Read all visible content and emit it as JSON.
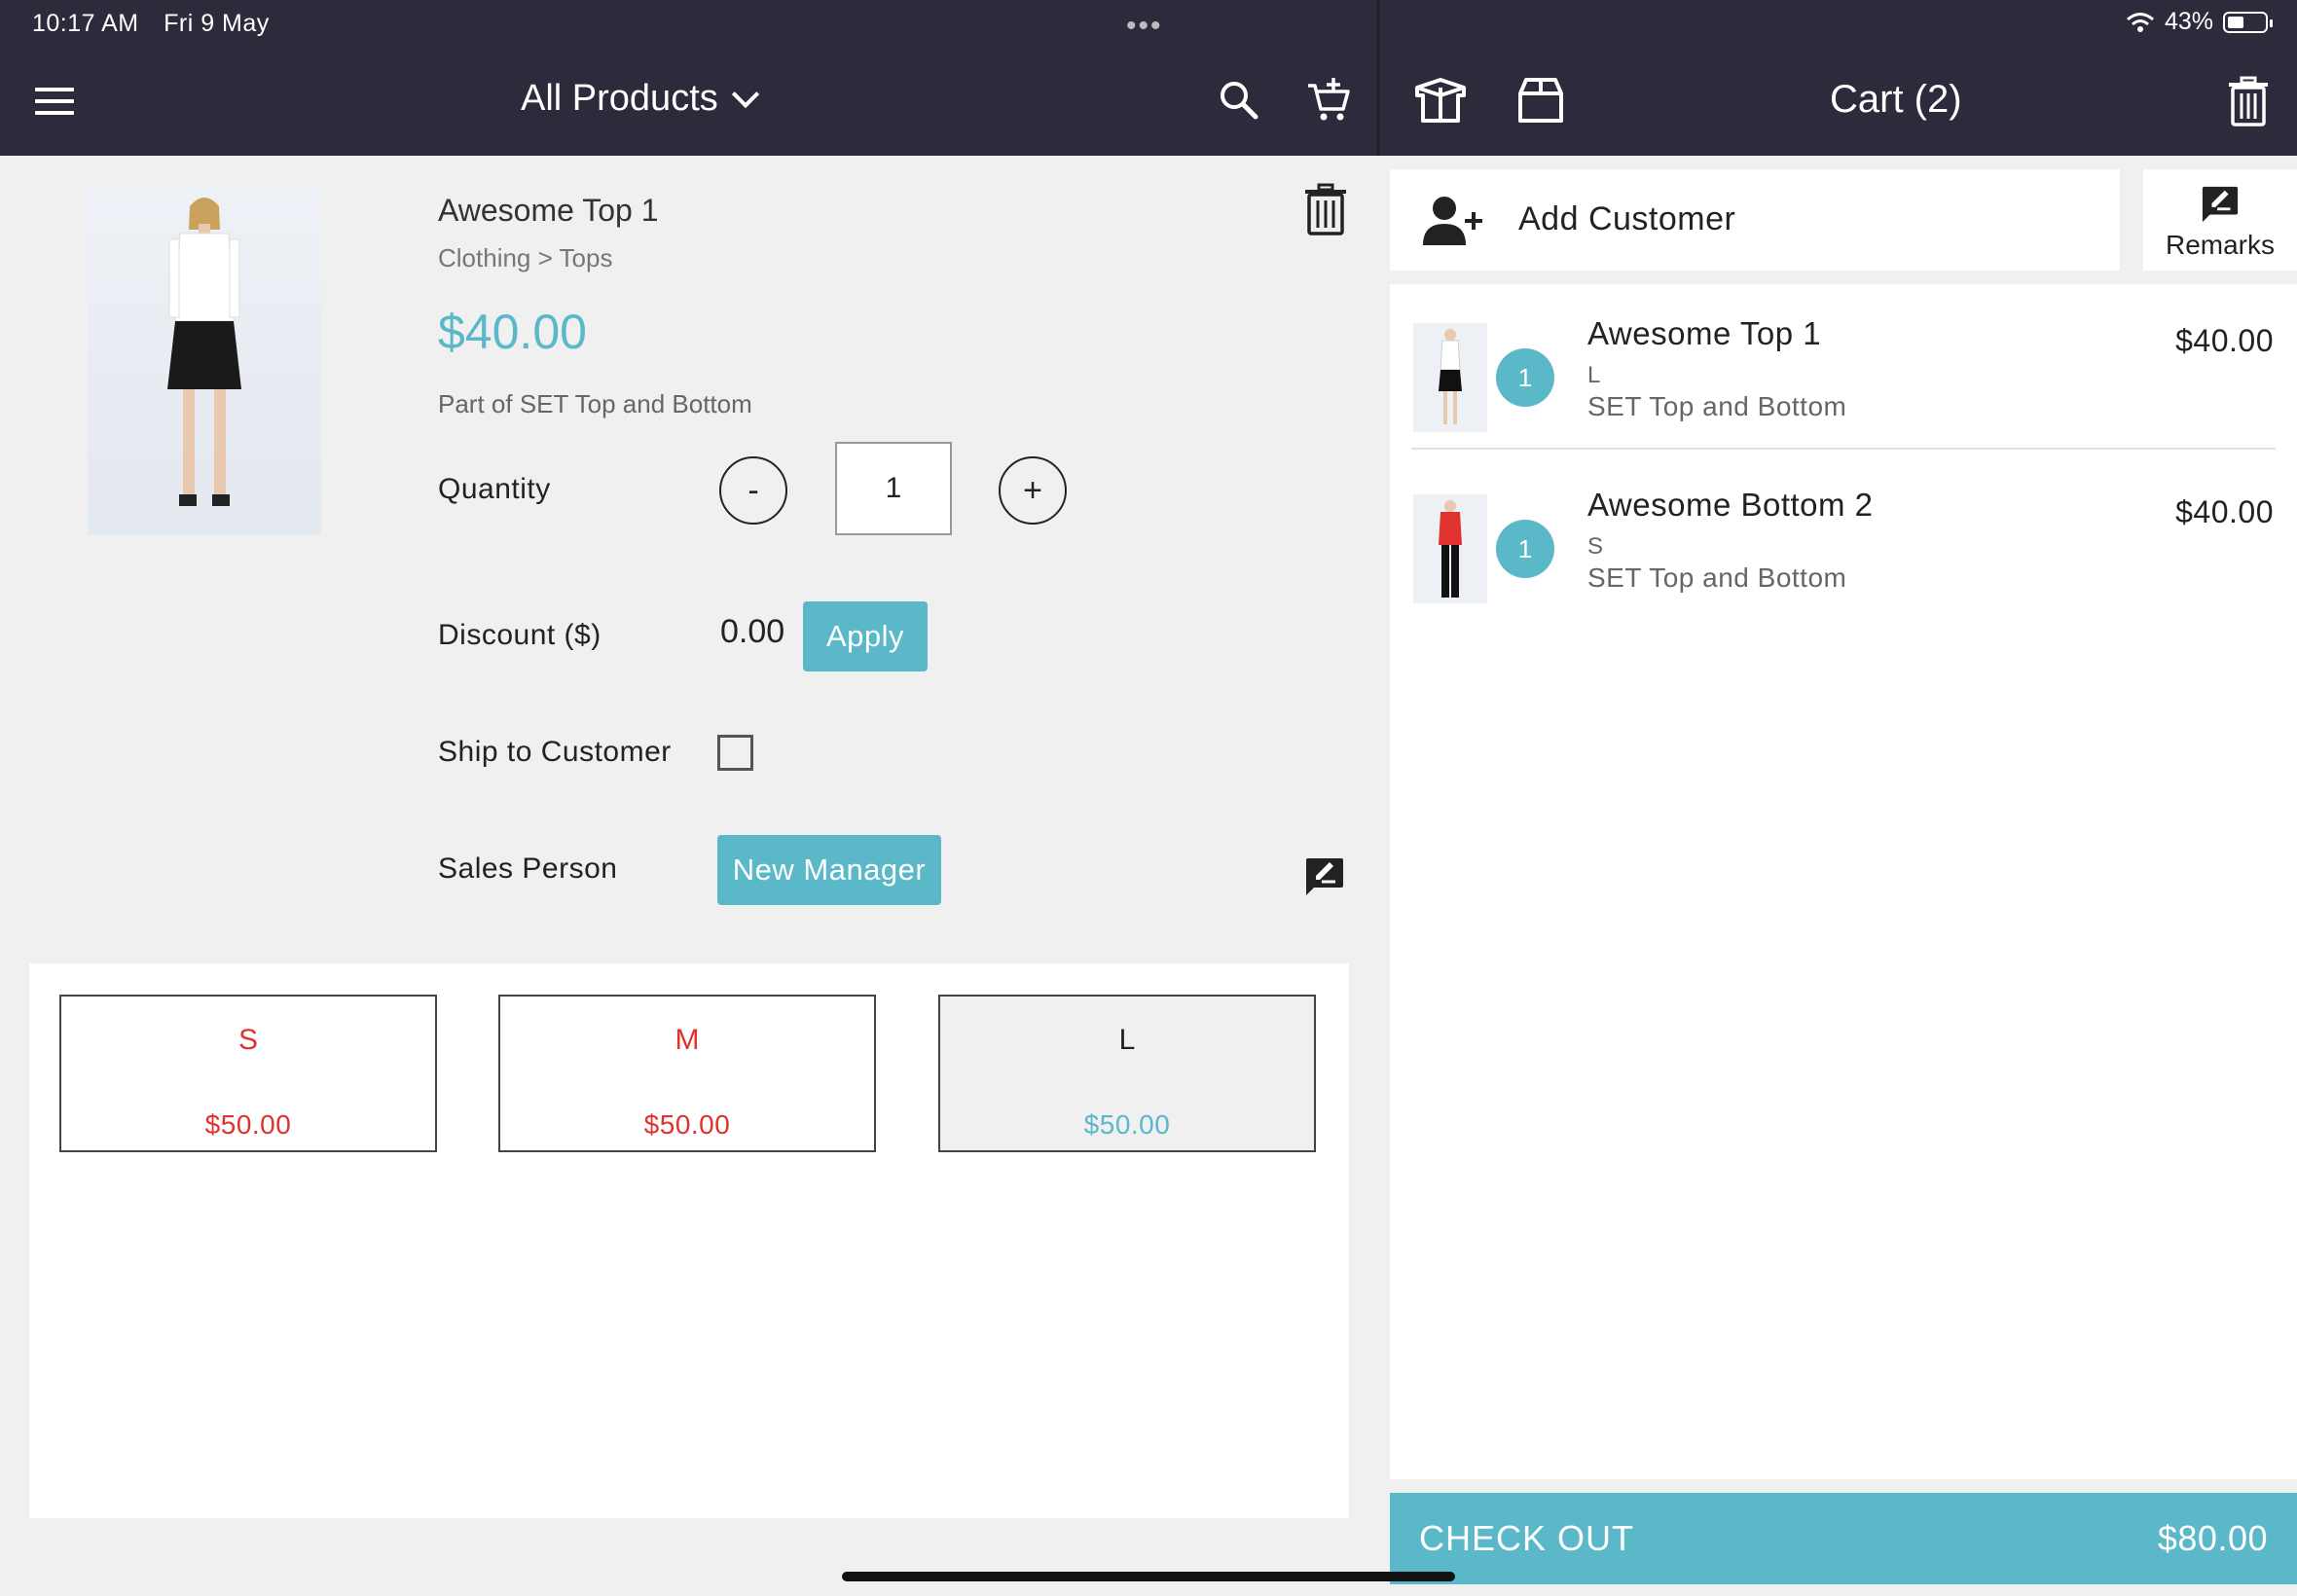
{
  "status_bar": {
    "time": "10:17 AM",
    "date": "Fri 9 May",
    "battery": "43%"
  },
  "header": {
    "products_title": "All Products",
    "cart_title": "Cart (2)"
  },
  "product": {
    "name": "Awesome Top 1",
    "category": "Clothing > Tops",
    "price": "$40.00",
    "set": "Part of SET Top and Bottom",
    "quantity_label": "Quantity",
    "quantity": "1",
    "minus": "-",
    "plus": "+",
    "discount_label": "Discount ($)",
    "discount": "0.00",
    "apply_label": "Apply",
    "ship_label": "Ship to Customer",
    "sales_label": "Sales Person",
    "sales_person": "New Manager"
  },
  "variants": [
    {
      "size": "S",
      "price": "$50.00",
      "state": "out-of-stock"
    },
    {
      "size": "M",
      "price": "$50.00",
      "state": "out-of-stock"
    },
    {
      "size": "L",
      "price": "$50.00",
      "state": "selected"
    }
  ],
  "customer": {
    "label": "Add Customer",
    "remarks_label": "Remarks"
  },
  "cart_items": [
    {
      "qty": "1",
      "name": "Awesome Top 1",
      "size": "L",
      "set": "SET Top and Bottom",
      "price": "$40.00",
      "shirt_color": "#ffffff",
      "bottom_color": "#111111"
    },
    {
      "qty": "1",
      "name": "Awesome Bottom 2",
      "size": "S",
      "set": "SET Top and Bottom",
      "price": "$40.00",
      "shirt_color": "#e0322f",
      "bottom_color": "#111111"
    }
  ],
  "checkout": {
    "label": "CHECK OUT",
    "total": "$80.00"
  },
  "colors": {
    "header": "#2b2b3b",
    "accent": "#5bb8c9",
    "out_of_stock": "#e0322f"
  }
}
